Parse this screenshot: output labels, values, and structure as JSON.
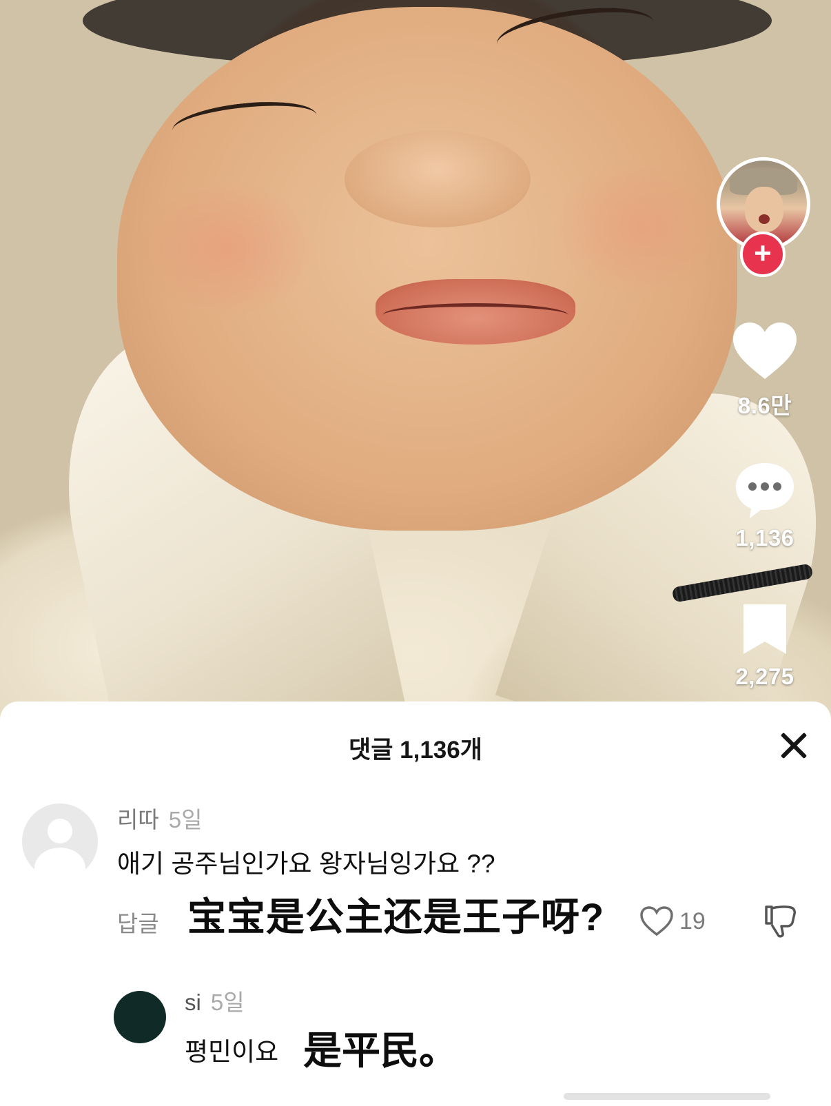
{
  "rail": {
    "follow_symbol": "+",
    "likes": "8.6만",
    "comments": "1,136",
    "saves": "2,275"
  },
  "icons": {
    "like": "heart-icon",
    "comment": "comment-bubble-icon",
    "save": "bookmark-icon",
    "close": "close-icon",
    "dislike": "thumbs-down-icon"
  },
  "sheet": {
    "title": "댓글 1,136개"
  },
  "comments": [
    {
      "user": "리따",
      "time": "5일",
      "text": "애기 공주님인가요 왕자님잉가요 ??",
      "reply_label": "답글",
      "likes": "19",
      "translation_overlay": "宝宝是公主还是王子呀?"
    },
    {
      "user": "si",
      "time": "5일",
      "text": "평민이요",
      "translation_overlay": "是平民。"
    }
  ],
  "colors": {
    "follow_red": "#e8334f",
    "sheet_bg": "#ffffff"
  }
}
